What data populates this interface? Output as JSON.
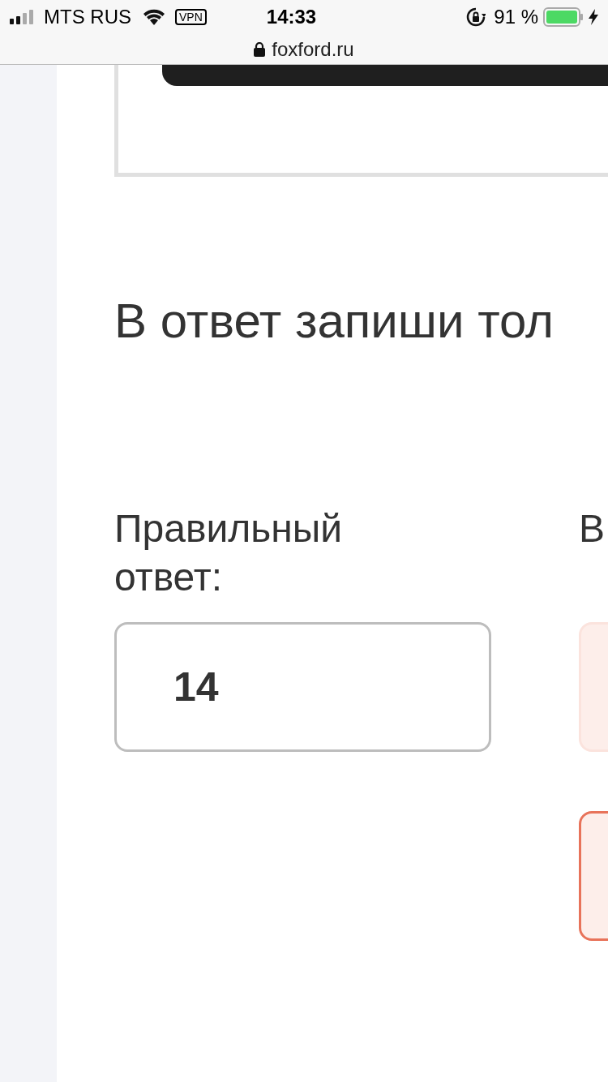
{
  "status_bar": {
    "carrier": "MTS RUS",
    "vpn": "VPN",
    "time": "14:33",
    "battery": "91 %"
  },
  "address_bar": {
    "url": "foxford.ru"
  },
  "task": {
    "instruction": "В ответ запиши тол"
  },
  "answer_columns": [
    {
      "label": "Правильный ответ:",
      "boxes": [
        {
          "kind": "correct",
          "value": "14"
        }
      ]
    },
    {
      "label": "В",
      "boxes": [
        {
          "kind": "neutral"
        },
        {
          "kind": "wrong"
        }
      ]
    }
  ]
}
